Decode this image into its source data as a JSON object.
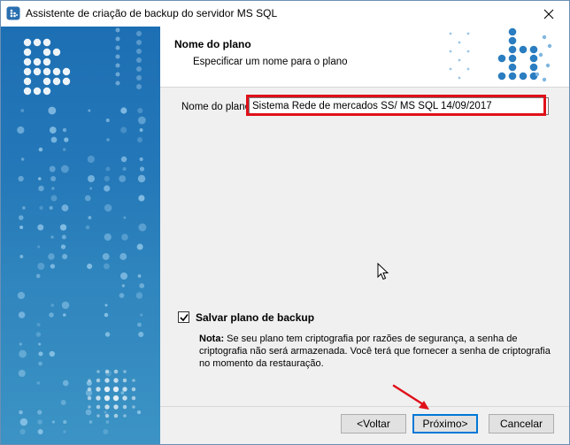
{
  "window": {
    "title": "Assistente de criação de backup do servidor MS SQL",
    "app_icon": "database-backup-icon",
    "close_icon": "close-icon"
  },
  "header": {
    "title": "Nome do plano",
    "subtitle": "Especificar um nome para o plano",
    "logo_icon": "dot-logo-icon"
  },
  "form": {
    "plan_name_label": "Nome do plano",
    "plan_name_value": "Sistema Rede de mercados SS/ MS SQL 14/09/2017",
    "save_plan_label": "Salvar plano de backup",
    "save_plan_checked": true,
    "note_label": "Nota:",
    "note_text": " Se seu plano tem criptografia por razões de segurança, a senha de criptografia não será armazenada. Você terá que fornecer a senha de criptografia no momento da restauração."
  },
  "buttons": {
    "back": "<Voltar",
    "next": "Próximo>",
    "cancel": "Cancelar"
  },
  "colors": {
    "accent": "#0078d7",
    "highlight": "#e0101a",
    "side_panel": "#1d6fb3"
  }
}
